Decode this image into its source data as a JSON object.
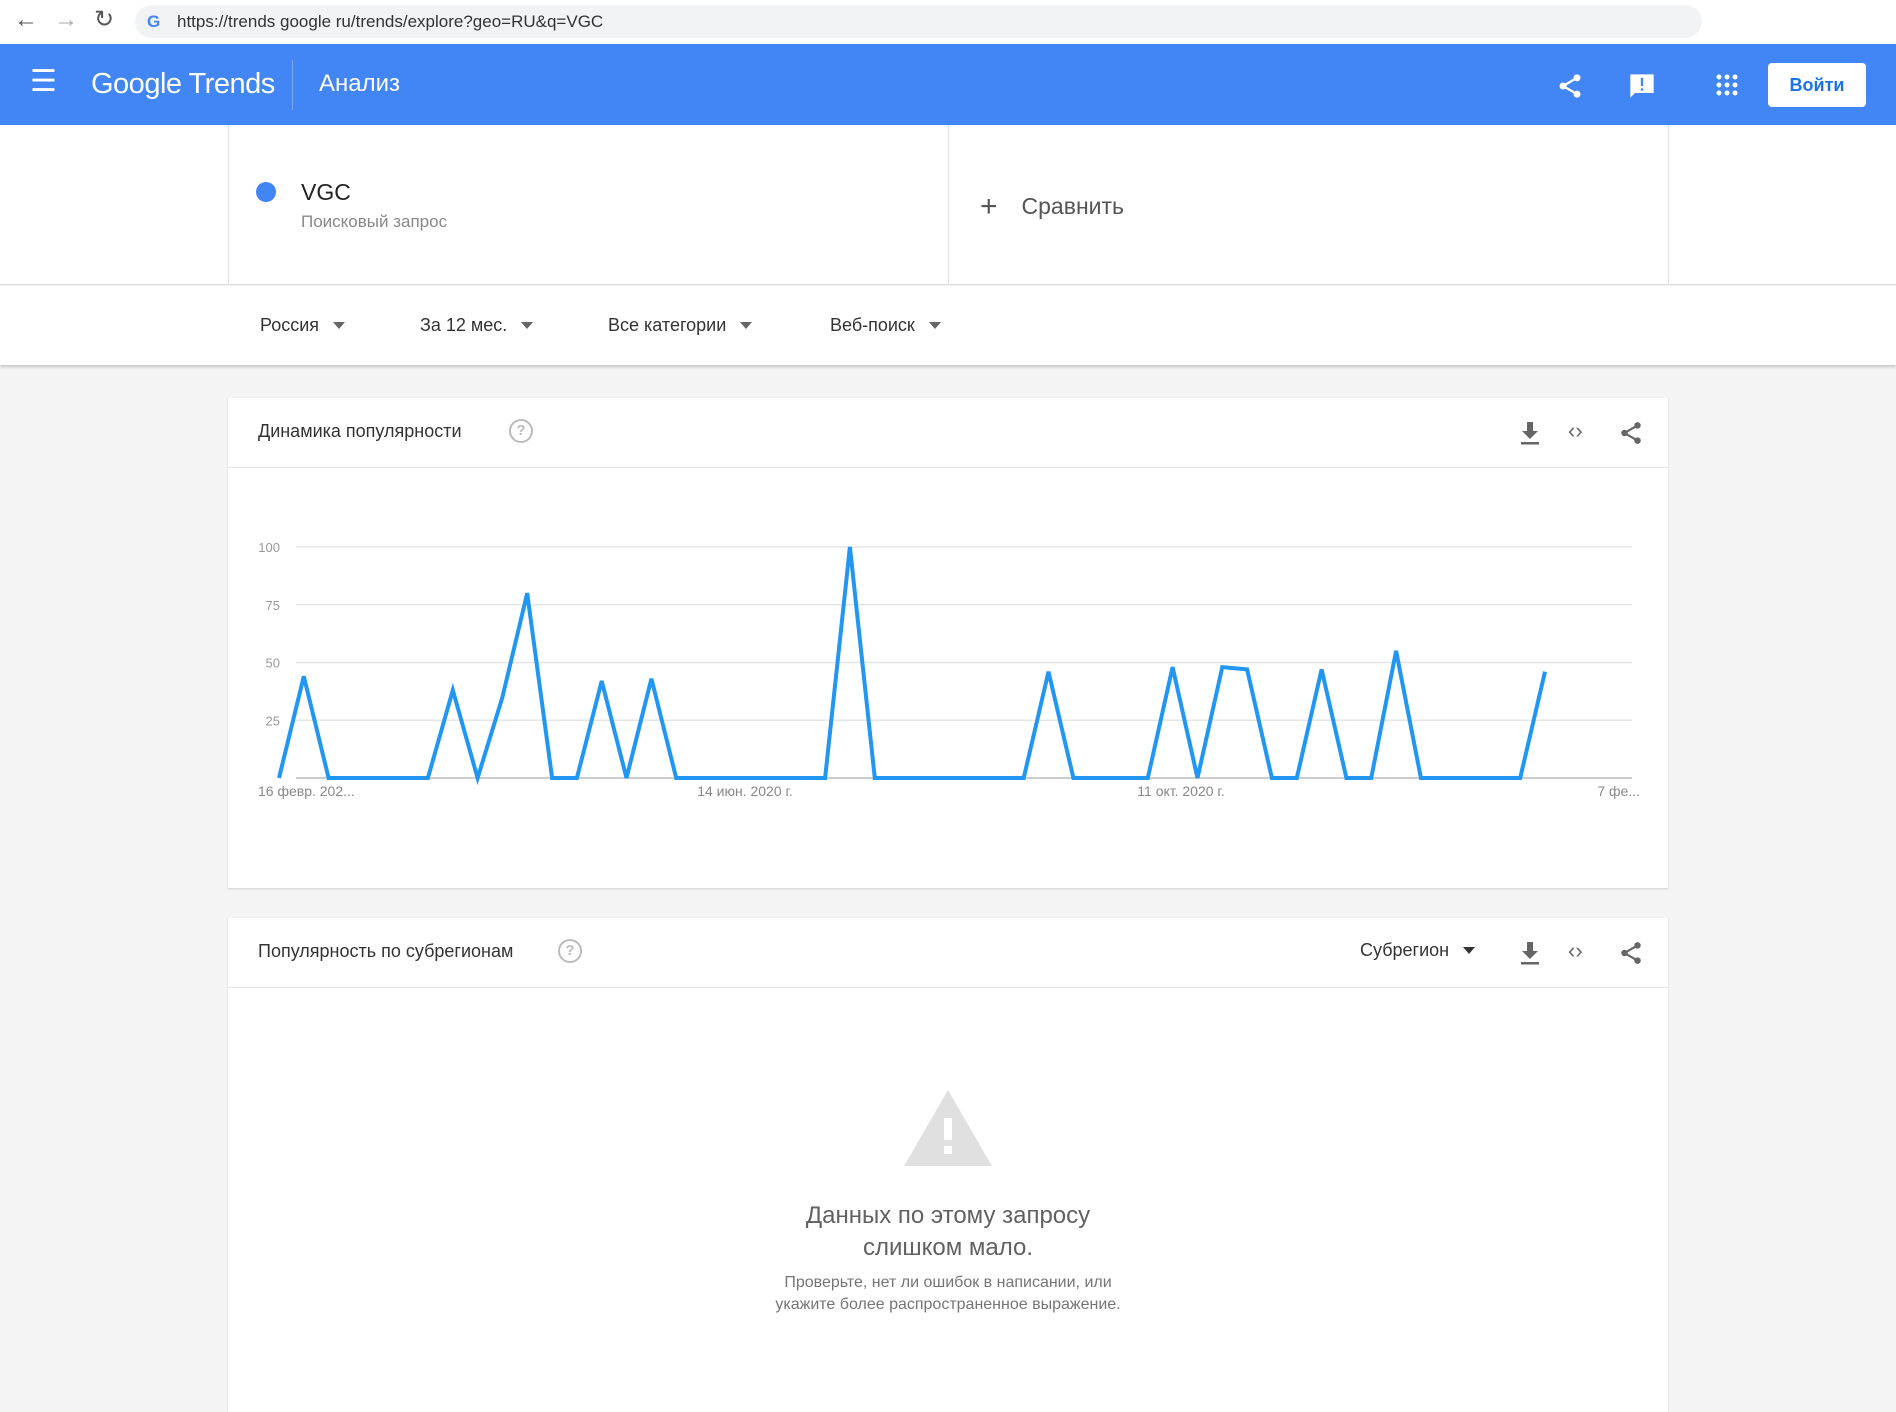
{
  "browser": {
    "url": "https://trends google ru/trends/explore?geo=RU&q=VGC"
  },
  "header": {
    "logo": "Google Trends",
    "title": "Анализ",
    "login_label": "Войти"
  },
  "search": {
    "term": "VGC",
    "term_type": "Поисковый запрос",
    "compare_label": "Сравнить",
    "term_color": "#4285f4"
  },
  "filters": [
    {
      "label": "Россия"
    },
    {
      "label": "За 12 мес."
    },
    {
      "label": "Все категории"
    },
    {
      "label": "Веб-поиск"
    }
  ],
  "interest_card": {
    "title": "Динамика популярности"
  },
  "subregion_card": {
    "title": "Популярность по субрегионам",
    "selector": "Субрегион",
    "empty_title_1": "Данных по этому запросу",
    "empty_title_2": "слишком мало.",
    "empty_text_1": "Проверьте, нет ли ошибок в написании, или",
    "empty_text_2": "укажите более распространенное выражение."
  },
  "chart_data": {
    "type": "line",
    "title": "Динамика популярности",
    "ylim": [
      0,
      100
    ],
    "yticks": [
      "100",
      "75",
      "50",
      "25"
    ],
    "xtick_labels": [
      "16 февр. 202...",
      "14 июн. 2020 г.",
      "11 окт. 2020 г.",
      "7 фе..."
    ],
    "grid": true,
    "series": [
      {
        "name": "VGC",
        "color": "#2196f3",
        "values": [
          0,
          44,
          0,
          0,
          0,
          0,
          0,
          38,
          0,
          35,
          80,
          0,
          0,
          42,
          0,
          43,
          0,
          0,
          0,
          0,
          0,
          0,
          0,
          100,
          0,
          0,
          0,
          0,
          0,
          0,
          0,
          46,
          0,
          0,
          0,
          0,
          48,
          0,
          48,
          47,
          0,
          0,
          47,
          0,
          0,
          55,
          0,
          0,
          0,
          0,
          0,
          46
        ]
      }
    ]
  }
}
